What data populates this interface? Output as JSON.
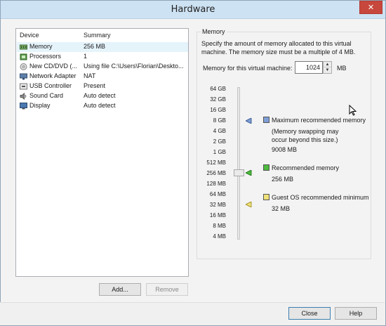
{
  "window": {
    "title": "Hardware"
  },
  "device_list": {
    "columns": {
      "device": "Device",
      "summary": "Summary"
    },
    "items": [
      {
        "device": "Memory",
        "summary": "256 MB",
        "icon": "memory-icon",
        "selected": true
      },
      {
        "device": "Processors",
        "summary": "1",
        "icon": "processor-icon"
      },
      {
        "device": "New CD/DVD (...",
        "summary": "Using file C:\\Users\\Florian\\Deskto...",
        "icon": "cd-dvd-icon"
      },
      {
        "device": "Network Adapter",
        "summary": "NAT",
        "icon": "network-adapter-icon"
      },
      {
        "device": "USB Controller",
        "summary": "Present",
        "icon": "usb-controller-icon"
      },
      {
        "device": "Sound Card",
        "summary": "Auto detect",
        "icon": "sound-card-icon"
      },
      {
        "device": "Display",
        "summary": "Auto detect",
        "icon": "display-icon"
      }
    ],
    "add_label": "Add...",
    "remove_label": "Remove"
  },
  "memory": {
    "group_title": "Memory",
    "description": "Specify the amount of memory allocated to this virtual machine. The memory size must be a multiple of 4 MB.",
    "field_label": "Memory for this virtual machine:",
    "value": "1024",
    "unit": "MB",
    "scale": [
      "64 GB",
      "32 GB",
      "16 GB",
      "8 GB",
      "4 GB",
      "2 GB",
      "1 GB",
      "512 MB",
      "256 MB",
      "128 MB",
      "64 MB",
      "32 MB",
      "16 MB",
      "8 MB",
      "4 MB"
    ],
    "max_recommended": {
      "label": "Maximum recommended memory",
      "note": "(Memory swapping may occur beyond this size.)",
      "value": "9008 MB",
      "color": "#7e9ed6"
    },
    "recommended": {
      "label": "Recommended memory",
      "value": "256 MB",
      "color": "#4cbb3e"
    },
    "guest_os": {
      "label": "Guest OS recommended minimum",
      "value": "32 MB",
      "color": "#f0e27a"
    }
  },
  "footer": {
    "close_label": "Close",
    "help_label": "Help"
  }
}
